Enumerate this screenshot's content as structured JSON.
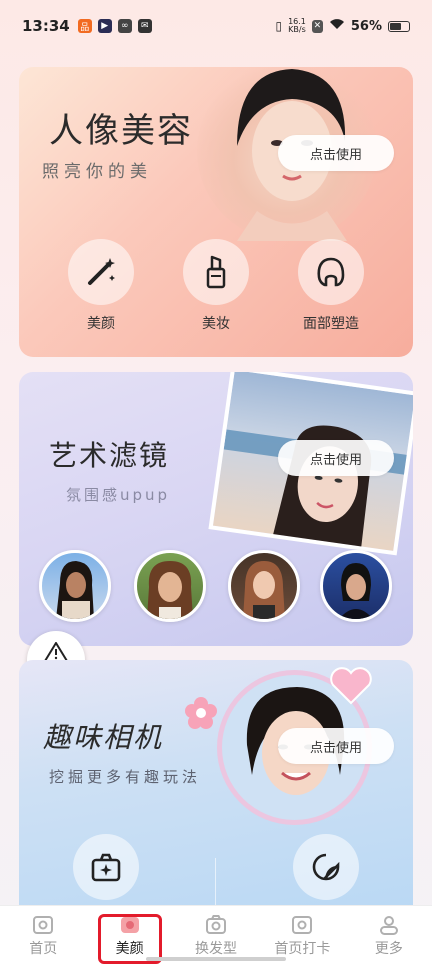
{
  "status_bar": {
    "time": "13:34",
    "net_speed_value": "16.1",
    "net_speed_unit": "KB/s",
    "battery": "56%"
  },
  "cards": {
    "portrait": {
      "title": "人像美容",
      "subtitle": "照亮你的美",
      "button": "点击使用",
      "features": [
        "美颜",
        "美妆",
        "面部塑造"
      ]
    },
    "filter": {
      "title": "艺术滤镜",
      "subtitle": "氛围感upup",
      "button": "点击使用"
    },
    "camera": {
      "title": "趣味相机",
      "subtitle": "挖掘更多有趣玩法",
      "button": "点击使用"
    }
  },
  "report": {
    "label": "举报"
  },
  "tabs": [
    "首页",
    "美颜",
    "换发型",
    "首页打卡",
    "更多"
  ],
  "active_tab": "美颜",
  "colors": {
    "highlight": "#e31b2b",
    "portrait_card": "#f7ad9d",
    "filter_card": "#c6c8ef",
    "camera_card": "#b9d8f4"
  }
}
